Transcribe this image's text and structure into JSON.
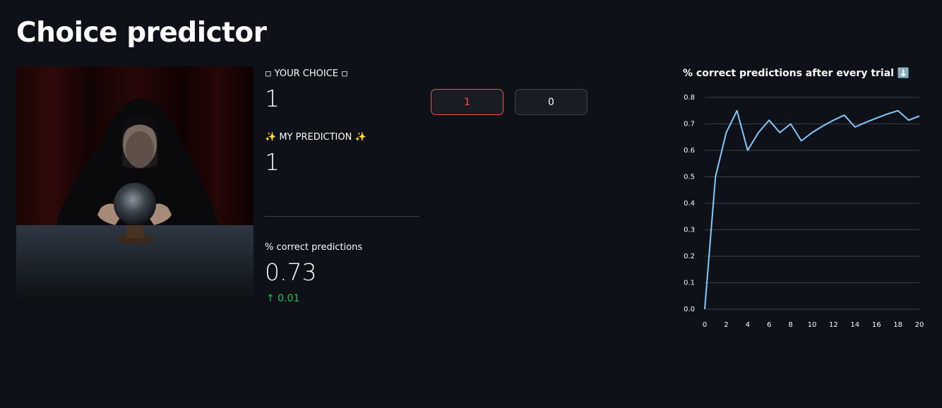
{
  "page": {
    "title": "Choice predictor"
  },
  "metrics": {
    "your_choice_label": "◽ YOUR CHOICE ◽",
    "your_choice_value": "1",
    "prediction_label": "✨ MY PREDICTION ✨",
    "prediction_value": "1",
    "correct_label": "% correct predictions",
    "correct_value": "0.73",
    "correct_delta": "↑ 0.01"
  },
  "buttons": {
    "one_label": "1",
    "zero_label": "0"
  },
  "colors": {
    "accent": "#ff4b4b",
    "line": "#83c9ff",
    "delta": "#21c354",
    "background": "#0e1117"
  },
  "chart_data": {
    "type": "line",
    "title": "% correct predictions after every trial ⬇️",
    "xlabel": "",
    "ylabel": "",
    "x": [
      0,
      1,
      2,
      3,
      4,
      5,
      6,
      7,
      8,
      9,
      10,
      11,
      12,
      13,
      14,
      15,
      16,
      17,
      18,
      19,
      20
    ],
    "series": [
      {
        "values": [
          0.0,
          0.5,
          0.667,
          0.75,
          0.6,
          0.667,
          0.714,
          0.667,
          0.7,
          0.636,
          0.667,
          0.692,
          0.714,
          0.733,
          0.688,
          0.706,
          0.722,
          0.737,
          0.75,
          0.714,
          0.73
        ]
      }
    ],
    "xlim": [
      0,
      20
    ],
    "ylim": [
      0,
      0.8
    ],
    "xticks": [
      "0",
      "2",
      "4",
      "6",
      "8",
      "10",
      "12",
      "14",
      "16",
      "18",
      "20"
    ],
    "yticks": [
      "0.0",
      "0.1",
      "0.2",
      "0.3",
      "0.4",
      "0.5",
      "0.6",
      "0.7",
      "0.8"
    ],
    "grid": true
  }
}
